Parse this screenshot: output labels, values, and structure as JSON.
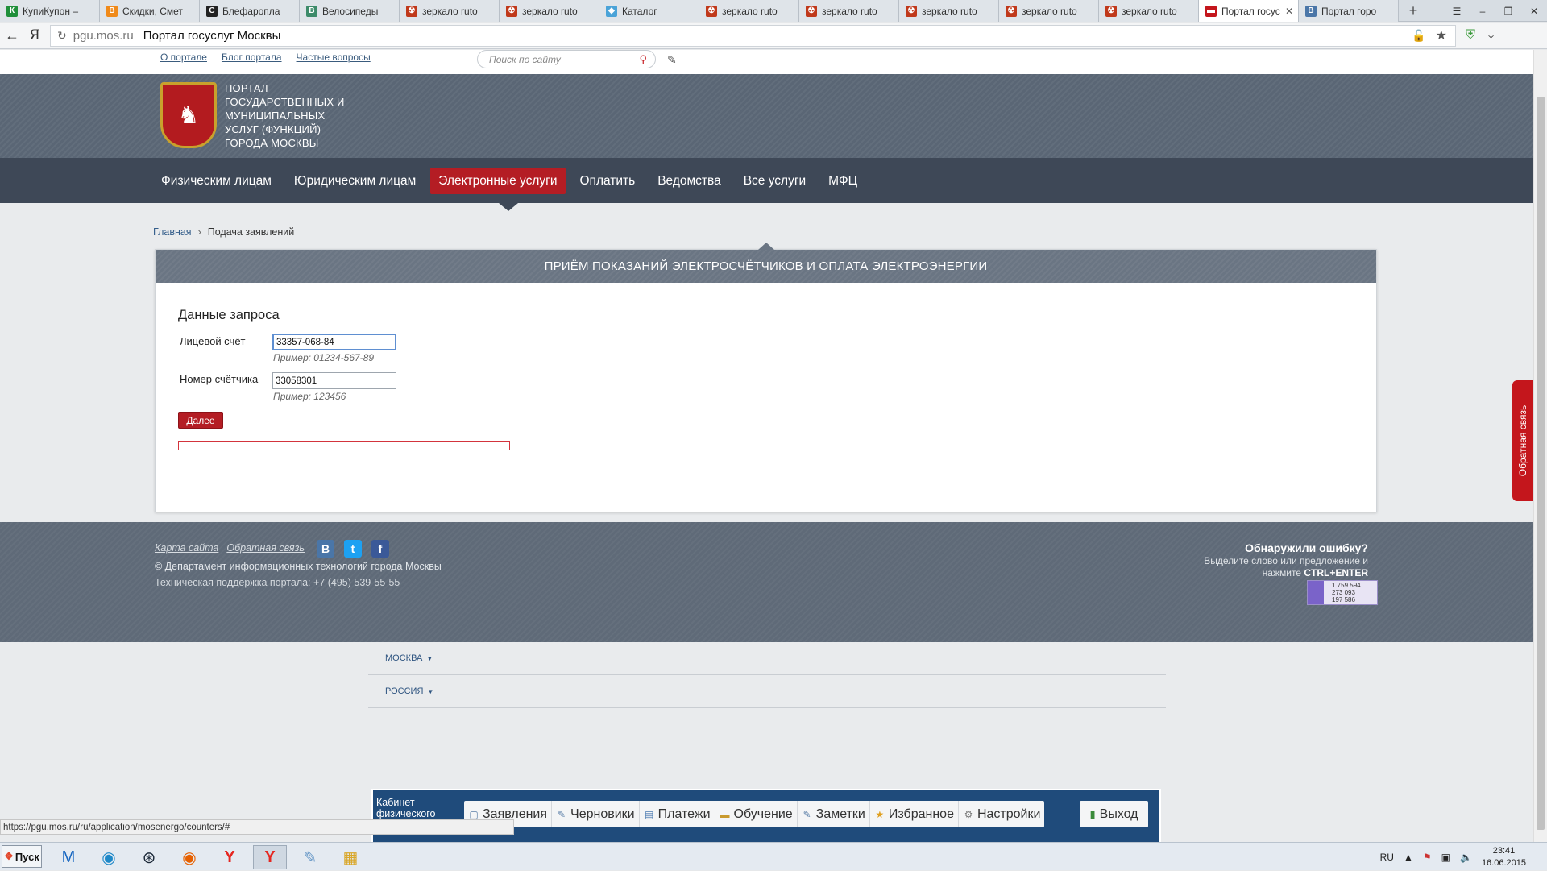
{
  "browser": {
    "tabs": [
      {
        "label": "КупиКупон –",
        "icon_color": "#1f8f3a",
        "icon_char": "К"
      },
      {
        "label": "Скидки, Смет",
        "icon_color": "#f08a1a",
        "icon_char": "В"
      },
      {
        "label": "Блефаропла",
        "icon_color": "#222222",
        "icon_char": "С"
      },
      {
        "label": "Велосипеды",
        "icon_color": "#3d8b6a",
        "icon_char": "В"
      },
      {
        "label": "зеркало ruto",
        "icon_color": "#c0391b",
        "icon_char": "☢"
      },
      {
        "label": "зеркало ruto",
        "icon_color": "#c0391b",
        "icon_char": "☢"
      },
      {
        "label": "Каталог",
        "icon_color": "#4aa3d8",
        "icon_char": "◆"
      },
      {
        "label": "зеркало ruto",
        "icon_color": "#c0391b",
        "icon_char": "☢"
      },
      {
        "label": "зеркало ruto",
        "icon_color": "#c0391b",
        "icon_char": "☢"
      },
      {
        "label": "зеркало ruto",
        "icon_color": "#c0391b",
        "icon_char": "☢"
      },
      {
        "label": "зеркало ruto",
        "icon_color": "#c0391b",
        "icon_char": "☢"
      },
      {
        "label": "зеркало ruto",
        "icon_color": "#c0391b",
        "icon_char": "☢"
      },
      {
        "label": "Портал госус",
        "icon_color": "#c4161c",
        "icon_char": "▬",
        "active": true
      },
      {
        "label": "Портал горо",
        "icon_color": "#4a76a8",
        "icon_char": "В"
      }
    ],
    "address": {
      "domain": "pgu.mos.ru",
      "page_title": "Портал госуслуг Москвы"
    },
    "status_url": "https://pgu.mos.ru/ru/application/mosenergo/counters/#"
  },
  "page": {
    "top_links": [
      "О портале",
      "Блог портала",
      "Частые вопросы"
    ],
    "search_placeholder": "Поиск по сайту",
    "portal_title": "Портал государственных и муниципальных услуг (функций) города Москвы",
    "nav": [
      "Физическим лицам",
      "Юридическим лицам",
      "Электронные услуги",
      "Оплатить",
      "Ведомства",
      "Все услуги",
      "МФЦ"
    ],
    "nav_active": "Электронные услуги",
    "breadcrumb": {
      "home": "Главная",
      "separator": "›",
      "current": "Подача заявлений"
    },
    "panel_title": "Приём показаний электросчётчиков и оплата электроэнергии",
    "form": {
      "title": "Данные запроса",
      "account_label": "Лицевой счёт",
      "account_value": "33357-068-84",
      "account_hint": "Пример: 01234-567-89",
      "meter_label": "Номер счётчика",
      "meter_value": "33058301",
      "meter_hint": "Пример: 123456",
      "next_button": "Далее"
    },
    "feedback_tab": "Обратная связь",
    "footer": {
      "links": [
        "Карта сайта",
        "Обратная связь"
      ],
      "copyright": "© Департамент информационных технологий города Москвы",
      "support": "Техническая поддержка портала: +7 (495) 539-55-55",
      "error_title": "Обнаружили ошибку?",
      "error_text": "Выделите слово или предложение и нажмите",
      "error_keys": "CTRL+ENTER",
      "counter": [
        "1 759 594",
        "273 093",
        "197 586"
      ]
    },
    "regions": [
      "МОСКВА",
      "РОССИЯ"
    ],
    "cabinet": {
      "label": "Кабинет физического",
      "items": [
        "Заявления",
        "Черновики",
        "Платежи",
        "Обучение",
        "Заметки",
        "Избранное",
        "Настройки"
      ],
      "exit": "Выход"
    }
  },
  "taskbar": {
    "start": "Пуск",
    "lang": "RU",
    "time": "23:41",
    "date": "16.06.2015"
  },
  "colors": {
    "brand_red": "#b41d24",
    "header_gray": "#5a6675",
    "nav_dark": "#3e4857",
    "link_blue": "#355e8b"
  }
}
